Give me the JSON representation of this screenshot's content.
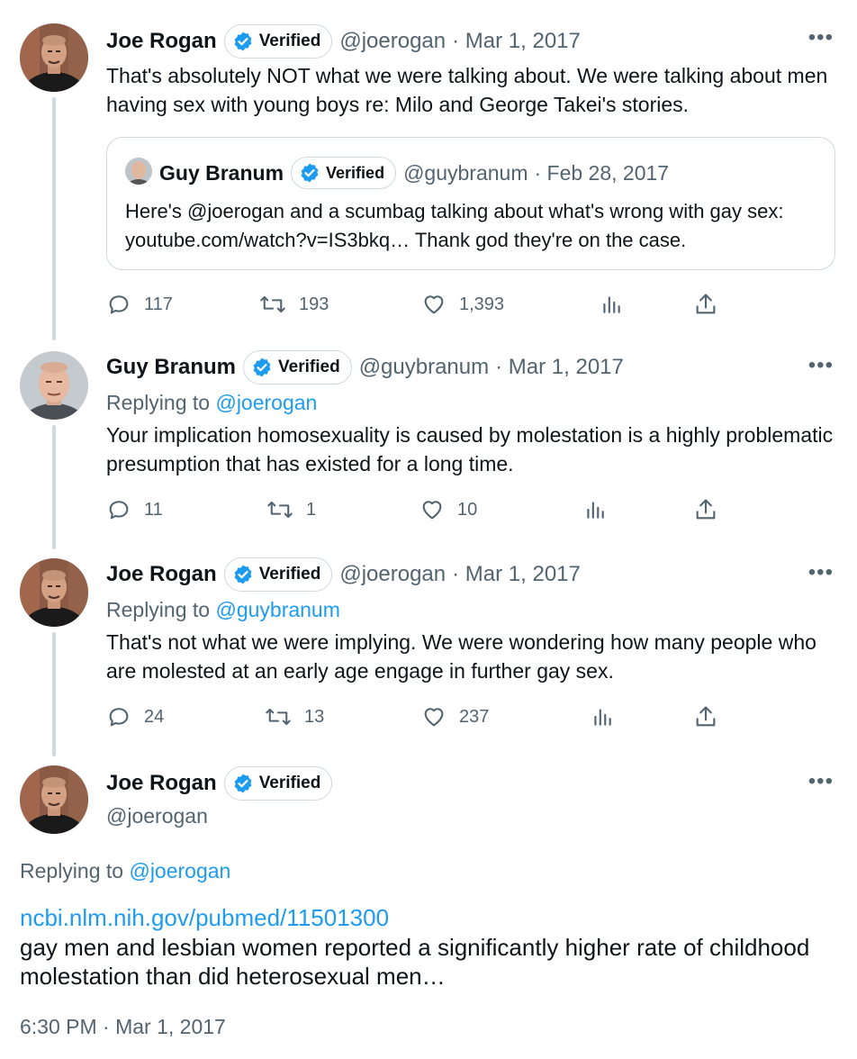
{
  "tweets": [
    {
      "name": "Joe Rogan",
      "badge": "Verified",
      "handle": "@joerogan",
      "date": "· Mar 1, 2017",
      "more": "•••",
      "text": "That's absolutely NOT what we were talking about. We were talking about men having sex with young boys re: Milo and George Takei's stories.",
      "quote": {
        "name": "Guy Branum",
        "badge": "Verified",
        "handle": "@guybranum",
        "date": "· Feb 28, 2017",
        "text": "Here's @joerogan and a scumbag talking about what's wrong with gay sex: youtube.com/watch?v=IS3bkq… Thank god they're on the case."
      },
      "replies": "117",
      "retweets": "193",
      "likes": "1,393"
    },
    {
      "name": "Guy Branum",
      "badge": "Verified",
      "handle": "@guybranum",
      "date": "· Mar 1, 2017",
      "more": "•••",
      "replying_label": "Replying to ",
      "replying_to": "@joerogan",
      "text": "Your implication homosexuality is caused by molestation is a highly problematic presumption that has existed for a long time.",
      "replies": "11",
      "retweets": "1",
      "likes": "10"
    },
    {
      "name": "Joe Rogan",
      "badge": "Verified",
      "handle": "@joerogan",
      "date": "· Mar 1, 2017",
      "more": "•••",
      "replying_label": "Replying to ",
      "replying_to": "@guybranum",
      "text": "That's not what we were implying.  We were wondering how many people who are molested at an early age engage in further gay sex.",
      "replies": "24",
      "retweets": "13",
      "likes": "237"
    }
  ],
  "focus": {
    "name": "Joe Rogan",
    "badge": "Verified",
    "handle": "@joerogan",
    "more": "•••",
    "replying_label": "Replying to ",
    "replying_to": "@joerogan",
    "link": "ncbi.nlm.nih.gov/pubmed/11501300",
    "text": "gay men and lesbian women reported a significantly higher rate of childhood molestation than did heterosexual men…",
    "timestamp": "6:30 PM · Mar 1, 2017"
  },
  "colors": {
    "verified_blue": "#1d9bf0",
    "secondary_text": "#536471",
    "thread_line": "#cfd9de"
  },
  "icons": [
    "reply-icon",
    "retweet-icon",
    "like-icon",
    "views-icon",
    "share-icon",
    "verified-check-icon",
    "more-icon"
  ]
}
